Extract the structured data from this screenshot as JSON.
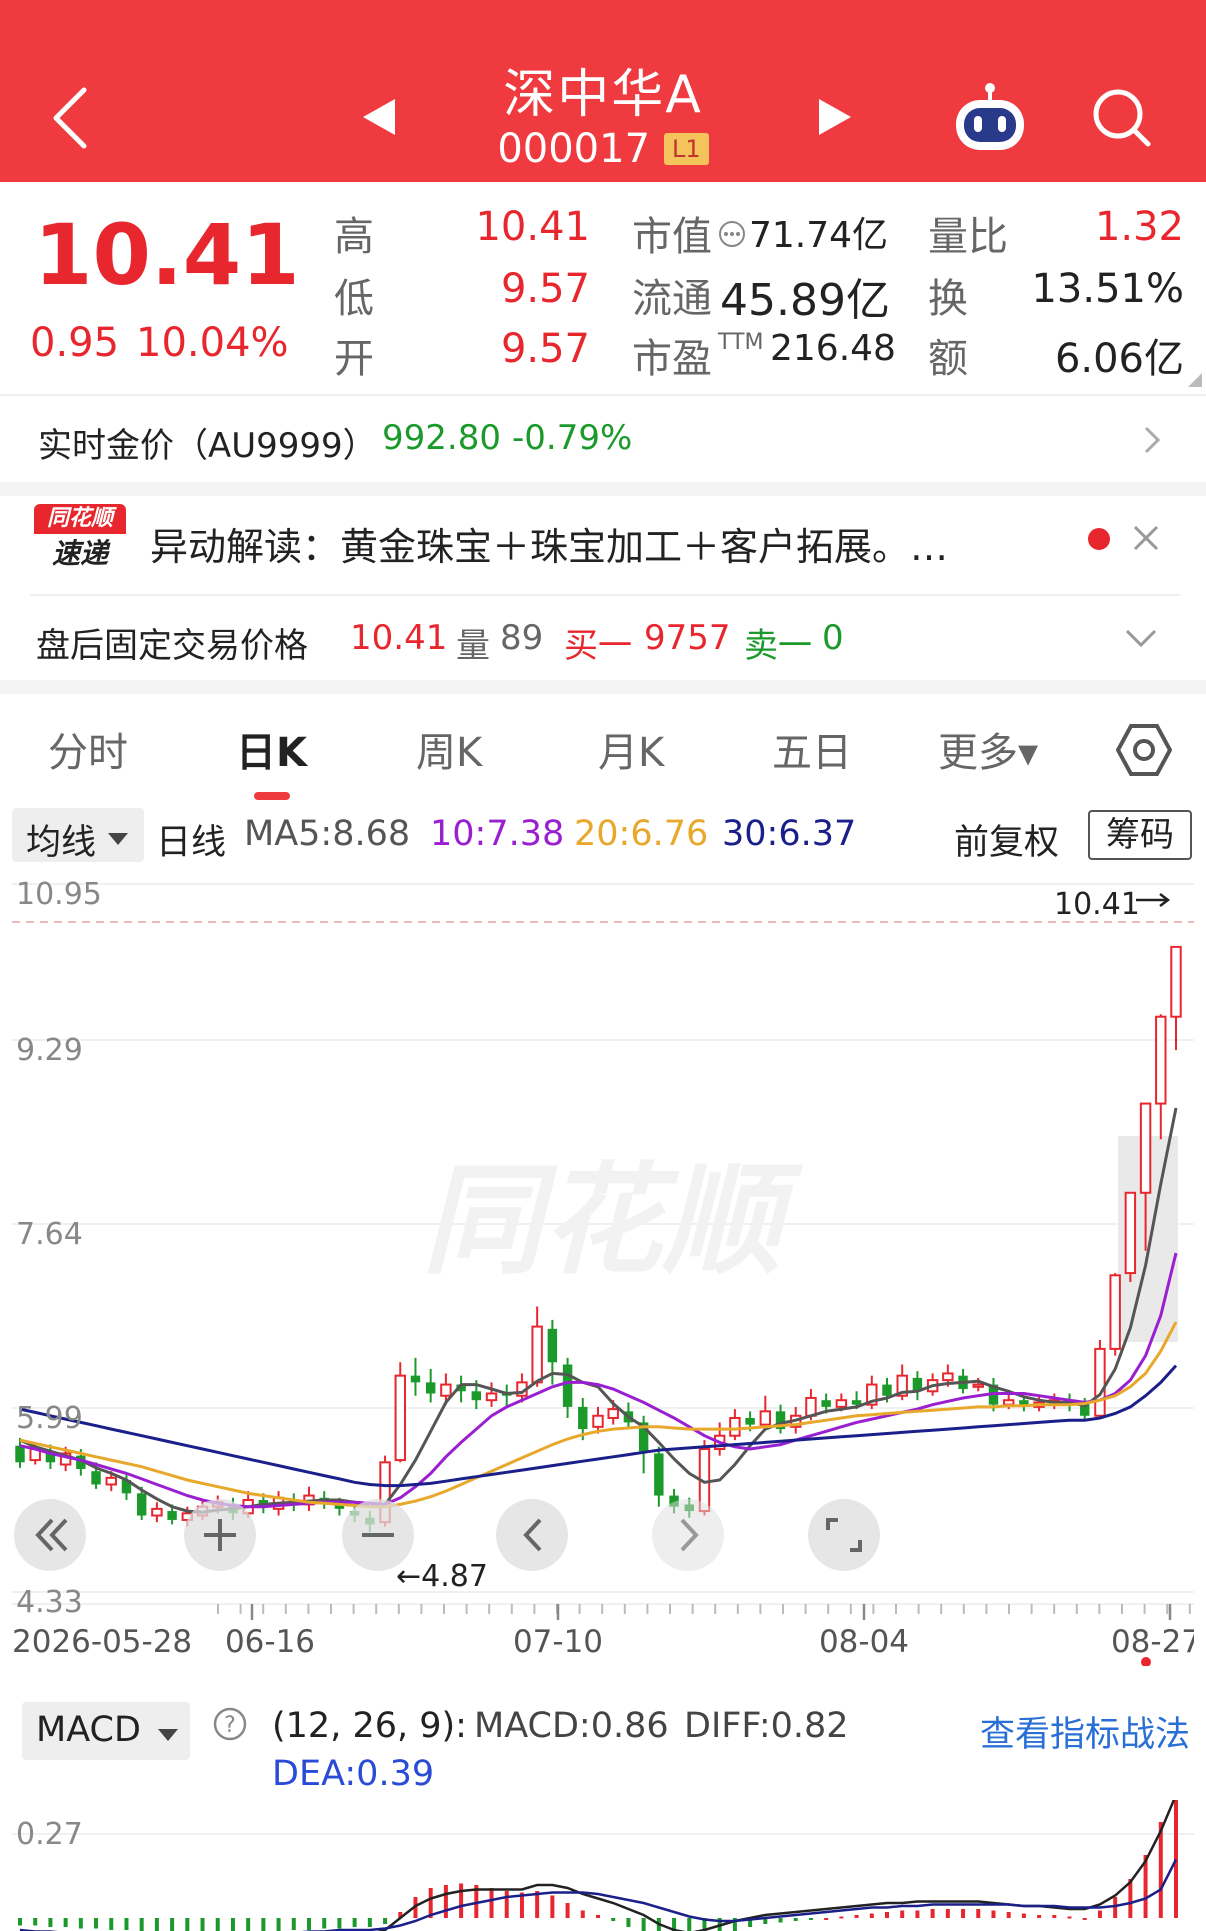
{
  "header": {
    "stock_name": "深中华A",
    "stock_code": "000017",
    "level_badge": "L1"
  },
  "quote": {
    "price": "10.41",
    "change": "0.95",
    "change_pct": "10.04%",
    "high_label": "高",
    "high": "10.41",
    "low_label": "低",
    "low": "9.57",
    "open_label": "开",
    "open": "9.57",
    "mktcap_label": "市值",
    "mktcap": "71.74亿",
    "float_label": "流通",
    "float": "45.89亿",
    "pe_label": "市盈",
    "pe_sup": "TTM",
    "pe": "216.48",
    "volratio_label": "量比",
    "volratio": "1.32",
    "turnover_label": "换",
    "turnover": "13.51%",
    "amount_label": "额",
    "amount": "6.06亿"
  },
  "gold": {
    "label": "实时金价（AU9999）",
    "price": "992.80",
    "change_pct": "-0.79%"
  },
  "news": {
    "logo_top": "同花顺",
    "logo_bottom": "速递",
    "text": "异动解读：黄金珠宝＋珠宝加工＋客户拓展。…"
  },
  "after_hours": {
    "label": "盘后固定交易价格",
    "price": "10.41",
    "vol_label": "量",
    "vol": "89",
    "buy_label": "买一",
    "buy": "9757",
    "sell_label": "卖一",
    "sell": "0"
  },
  "tabs": [
    "分时",
    "日K",
    "周K",
    "月K",
    "五日",
    "更多▾"
  ],
  "active_tab": "日K",
  "ma_bar": {
    "dropdown": "均线",
    "period": "日线",
    "ma5": "MA5:8.68",
    "ma10": "10:7.38",
    "ma20": "20:6.76",
    "ma30": "30:6.37",
    "adjust": "前复权",
    "chip": "筹码"
  },
  "colors": {
    "header_red": "#ef3b3f",
    "up": "#e8262e",
    "down": "#1b9a2b",
    "ma5": "#555555",
    "ma10": "#9a1fd1",
    "ma20": "#e7a82c",
    "ma30": "#1b1f8a"
  },
  "watermark": "同花顺",
  "macd_header": {
    "dropdown": "MACD",
    "params": "(12, 26, 9):",
    "macd": "MACD:0.86",
    "diff": "DIFF:0.82",
    "dea": "DEA:0.39",
    "link": "查看指标战法"
  },
  "chart_data": [
    {
      "type": "candlestick",
      "y_ticks": [
        "10.95",
        "9.29",
        "7.64",
        "5.99",
        "4.33"
      ],
      "ylim": [
        4.33,
        10.95
      ],
      "x_ticks": [
        "2026-05-28",
        "06-16",
        "07-10",
        "08-04",
        "08-27"
      ],
      "annotations": {
        "max_label": "10.41",
        "min_label": "←4.87"
      },
      "candles": [
        [
          5.65,
          5.5,
          5.72,
          5.45
        ],
        [
          5.52,
          5.62,
          5.68,
          5.48
        ],
        [
          5.6,
          5.5,
          5.66,
          5.44
        ],
        [
          5.48,
          5.58,
          5.64,
          5.42
        ],
        [
          5.56,
          5.44,
          5.62,
          5.38
        ],
        [
          5.42,
          5.3,
          5.5,
          5.26
        ],
        [
          5.3,
          5.36,
          5.42,
          5.24
        ],
        [
          5.34,
          5.22,
          5.4,
          5.16
        ],
        [
          5.22,
          5.02,
          5.28,
          4.98
        ],
        [
          5.02,
          5.08,
          5.14,
          4.96
        ],
        [
          5.06,
          4.98,
          5.12,
          4.94
        ],
        [
          4.98,
          5.04,
          5.1,
          4.92
        ],
        [
          5.02,
          5.1,
          5.16,
          4.98
        ],
        [
          5.1,
          5.14,
          5.2,
          5.04
        ],
        [
          5.12,
          5.04,
          5.18,
          4.98
        ],
        [
          5.04,
          5.16,
          5.24,
          5.0
        ],
        [
          5.16,
          5.1,
          5.22,
          5.04
        ],
        [
          5.08,
          5.18,
          5.24,
          5.02
        ],
        [
          5.16,
          5.12,
          5.22,
          5.06
        ],
        [
          5.12,
          5.2,
          5.28,
          5.06
        ],
        [
          5.18,
          5.14,
          5.24,
          5.08
        ],
        [
          5.12,
          5.08,
          5.18,
          5.02
        ],
        [
          5.06,
          5.02,
          5.12,
          4.96
        ],
        [
          5.0,
          4.94,
          5.06,
          4.87
        ],
        [
          4.96,
          5.5,
          5.56,
          4.92
        ],
        [
          5.52,
          6.28,
          6.4,
          5.5
        ],
        [
          6.28,
          6.22,
          6.44,
          6.1
        ],
        [
          6.22,
          6.12,
          6.34,
          6.04
        ],
        [
          6.1,
          6.2,
          6.3,
          6.02
        ],
        [
          6.2,
          6.14,
          6.28,
          6.04
        ],
        [
          6.14,
          6.06,
          6.24,
          5.98
        ],
        [
          6.06,
          6.12,
          6.22,
          6.0
        ],
        [
          6.12,
          6.1,
          6.2,
          6.0
        ],
        [
          6.1,
          6.22,
          6.3,
          6.04
        ],
        [
          6.22,
          6.72,
          6.9,
          6.18
        ],
        [
          6.7,
          6.4,
          6.78,
          6.2
        ],
        [
          6.38,
          6.0,
          6.44,
          5.9
        ],
        [
          6.0,
          5.8,
          6.08,
          5.7
        ],
        [
          5.82,
          5.92,
          6.0,
          5.76
        ],
        [
          5.9,
          5.98,
          6.06,
          5.84
        ],
        [
          5.96,
          5.86,
          6.04,
          5.8
        ],
        [
          5.86,
          5.6,
          5.92,
          5.4
        ],
        [
          5.58,
          5.2,
          5.64,
          5.1
        ],
        [
          5.2,
          5.1,
          5.26,
          5.04
        ],
        [
          5.12,
          5.06,
          5.18,
          5.0
        ],
        [
          5.06,
          5.62,
          5.7,
          5.02
        ],
        [
          5.62,
          5.74,
          5.86,
          5.56
        ],
        [
          5.74,
          5.9,
          5.98,
          5.7
        ],
        [
          5.9,
          5.84,
          5.96,
          5.78
        ],
        [
          5.84,
          5.96,
          6.1,
          5.8
        ],
        [
          5.96,
          5.8,
          6.02,
          5.76
        ],
        [
          5.82,
          5.92,
          6.0,
          5.76
        ],
        [
          5.92,
          6.08,
          6.16,
          5.88
        ],
        [
          6.06,
          6.0,
          6.12,
          5.94
        ],
        [
          6.0,
          6.06,
          6.12,
          5.96
        ],
        [
          6.06,
          6.02,
          6.14,
          5.98
        ],
        [
          6.02,
          6.2,
          6.28,
          5.98
        ],
        [
          6.2,
          6.1,
          6.26,
          6.04
        ],
        [
          6.1,
          6.28,
          6.38,
          6.06
        ],
        [
          6.26,
          6.14,
          6.32,
          6.06
        ],
        [
          6.14,
          6.24,
          6.3,
          6.1
        ],
        [
          6.24,
          6.3,
          6.38,
          6.18
        ],
        [
          6.28,
          6.16,
          6.34,
          6.12
        ],
        [
          6.18,
          6.2,
          6.26,
          6.14
        ],
        [
          6.2,
          6.02,
          6.26,
          5.96
        ],
        [
          6.02,
          6.06,
          6.12,
          5.98
        ],
        [
          6.06,
          6.0,
          6.1,
          5.96
        ],
        [
          6.0,
          6.04,
          6.1,
          5.96
        ],
        [
          6.04,
          6.06,
          6.12,
          5.98
        ],
        [
          6.06,
          6.02,
          6.12,
          5.96
        ],
        [
          6.02,
          5.92,
          6.08,
          5.88
        ],
        [
          5.92,
          6.52,
          6.6,
          5.9
        ],
        [
          6.52,
          7.18,
          7.2,
          6.46
        ],
        [
          7.2,
          7.92,
          7.92,
          7.12
        ],
        [
          7.92,
          8.72,
          8.72,
          7.4
        ],
        [
          8.72,
          9.57,
          9.6,
          8.4
        ],
        [
          9.57,
          10.41,
          10.41,
          9.2
        ]
      ],
      "series": [
        {
          "name": "MA5",
          "values": [
            5.7,
            5.64,
            5.6,
            5.56,
            5.52,
            5.45,
            5.4,
            5.34,
            5.25,
            5.17,
            5.1,
            5.06,
            5.05,
            5.07,
            5.08,
            5.1,
            5.12,
            5.13,
            5.14,
            5.15,
            5.16,
            5.16,
            5.14,
            5.1,
            5.12,
            5.3,
            5.52,
            5.78,
            6.04,
            6.2,
            6.2,
            6.16,
            6.12,
            6.13,
            6.23,
            6.3,
            6.29,
            6.22,
            6.18,
            6.03,
            5.91,
            5.82,
            5.68,
            5.53,
            5.4,
            5.32,
            5.34,
            5.48,
            5.65,
            5.8,
            5.85,
            5.88,
            5.92,
            5.96,
            5.98,
            6.0,
            6.05,
            6.08,
            6.13,
            6.14,
            6.19,
            6.21,
            6.22,
            6.23,
            6.18,
            6.14,
            6.09,
            6.06,
            6.04,
            6.04,
            6.01,
            6.11,
            6.34,
            6.71,
            7.27,
            8.0,
            8.68
          ]
        },
        {
          "name": "10",
          "values": [
            5.65,
            5.62,
            5.58,
            5.55,
            5.52,
            5.48,
            5.44,
            5.4,
            5.35,
            5.3,
            5.25,
            5.2,
            5.16,
            5.13,
            5.11,
            5.1,
            5.1,
            5.11,
            5.12,
            5.13,
            5.14,
            5.14,
            5.14,
            5.13,
            5.12,
            5.18,
            5.28,
            5.4,
            5.55,
            5.68,
            5.8,
            5.92,
            6.0,
            6.06,
            6.12,
            6.18,
            6.22,
            6.22,
            6.2,
            6.16,
            6.1,
            6.04,
            5.97,
            5.9,
            5.82,
            5.74,
            5.68,
            5.64,
            5.62,
            5.64,
            5.66,
            5.7,
            5.74,
            5.78,
            5.82,
            5.86,
            5.89,
            5.92,
            5.95,
            5.98,
            6.02,
            6.05,
            6.08,
            6.1,
            6.12,
            6.12,
            6.12,
            6.1,
            6.08,
            6.06,
            6.04,
            6.06,
            6.12,
            6.24,
            6.46,
            6.82,
            7.38
          ]
        },
        {
          "name": "20",
          "values": [
            5.7,
            5.67,
            5.64,
            5.61,
            5.58,
            5.55,
            5.52,
            5.49,
            5.46,
            5.42,
            5.38,
            5.34,
            5.31,
            5.28,
            5.25,
            5.22,
            5.2,
            5.18,
            5.16,
            5.14,
            5.13,
            5.12,
            5.11,
            5.1,
            5.1,
            5.12,
            5.15,
            5.19,
            5.24,
            5.3,
            5.36,
            5.42,
            5.48,
            5.54,
            5.6,
            5.66,
            5.71,
            5.75,
            5.78,
            5.8,
            5.81,
            5.82,
            5.82,
            5.81,
            5.8,
            5.8,
            5.8,
            5.8,
            5.81,
            5.82,
            5.83,
            5.84,
            5.86,
            5.88,
            5.9,
            5.92,
            5.93,
            5.94,
            5.95,
            5.96,
            5.97,
            5.98,
            5.99,
            6.0,
            6.0,
            6.01,
            6.01,
            6.02,
            6.02,
            6.02,
            6.03,
            6.06,
            6.1,
            6.18,
            6.3,
            6.5,
            6.76
          ]
        },
        {
          "name": "30",
          "values": [
            5.98,
            5.95,
            5.92,
            5.89,
            5.86,
            5.83,
            5.8,
            5.77,
            5.74,
            5.71,
            5.68,
            5.65,
            5.62,
            5.59,
            5.56,
            5.53,
            5.5,
            5.47,
            5.44,
            5.41,
            5.38,
            5.35,
            5.32,
            5.3,
            5.29,
            5.29,
            5.3,
            5.31,
            5.33,
            5.35,
            5.37,
            5.39,
            5.41,
            5.43,
            5.45,
            5.47,
            5.49,
            5.51,
            5.53,
            5.55,
            5.57,
            5.59,
            5.61,
            5.62,
            5.63,
            5.64,
            5.65,
            5.66,
            5.67,
            5.68,
            5.69,
            5.7,
            5.71,
            5.72,
            5.73,
            5.74,
            5.75,
            5.76,
            5.77,
            5.78,
            5.79,
            5.8,
            5.81,
            5.82,
            5.83,
            5.84,
            5.85,
            5.86,
            5.87,
            5.88,
            5.88,
            5.9,
            5.94,
            6.0,
            6.1,
            6.22,
            6.37
          ]
        }
      ]
    },
    {
      "type": "bar",
      "title": "MACD",
      "y_ticks": [
        "0.27"
      ],
      "values": [
        -0.05,
        -0.05,
        -0.06,
        -0.06,
        -0.07,
        -0.07,
        -0.08,
        -0.08,
        -0.09,
        -0.1,
        -0.1,
        -0.11,
        -0.11,
        -0.11,
        -0.1,
        -0.1,
        -0.09,
        -0.09,
        -0.08,
        -0.08,
        -0.07,
        -0.07,
        -0.06,
        -0.06,
        -0.04,
        0.04,
        0.14,
        0.2,
        0.22,
        0.23,
        0.22,
        0.2,
        0.18,
        0.17,
        0.18,
        0.15,
        0.1,
        0.05,
        0.02,
        -0.02,
        -0.06,
        -0.1,
        -0.16,
        -0.2,
        -0.22,
        -0.18,
        -0.14,
        -0.1,
        -0.06,
        -0.04,
        -0.03,
        -0.02,
        -0.01,
        0.0,
        0.01,
        0.02,
        0.03,
        0.04,
        0.05,
        0.05,
        0.06,
        0.06,
        0.06,
        0.06,
        0.05,
        0.04,
        0.03,
        0.02,
        0.02,
        0.01,
        0.0,
        0.05,
        0.14,
        0.26,
        0.42,
        0.64,
        0.86
      ],
      "series": [
        {
          "name": "DIFF",
          "values": [
            -0.1,
            -0.11,
            -0.12,
            -0.13,
            -0.14,
            -0.15,
            -0.16,
            -0.17,
            -0.18,
            -0.19,
            -0.2,
            -0.2,
            -0.2,
            -0.19,
            -0.18,
            -0.17,
            -0.16,
            -0.15,
            -0.14,
            -0.13,
            -0.12,
            -0.11,
            -0.11,
            -0.11,
            -0.08,
            0.0,
            0.08,
            0.13,
            0.16,
            0.18,
            0.19,
            0.19,
            0.19,
            0.19,
            0.22,
            0.22,
            0.2,
            0.16,
            0.13,
            0.1,
            0.06,
            0.02,
            -0.04,
            -0.08,
            -0.1,
            -0.08,
            -0.05,
            -0.02,
            0.0,
            0.02,
            0.03,
            0.04,
            0.05,
            0.06,
            0.07,
            0.08,
            0.09,
            0.1,
            0.1,
            0.11,
            0.11,
            0.11,
            0.11,
            0.11,
            0.1,
            0.09,
            0.08,
            0.08,
            0.07,
            0.06,
            0.06,
            0.09,
            0.15,
            0.24,
            0.38,
            0.58,
            0.82
          ]
        },
        {
          "name": "DEA",
          "values": [
            -0.08,
            -0.09,
            -0.09,
            -0.1,
            -0.11,
            -0.11,
            -0.12,
            -0.13,
            -0.14,
            -0.14,
            -0.15,
            -0.15,
            -0.15,
            -0.14,
            -0.13,
            -0.12,
            -0.12,
            -0.11,
            -0.1,
            -0.09,
            -0.09,
            -0.08,
            -0.08,
            -0.08,
            -0.07,
            -0.05,
            -0.02,
            0.02,
            0.05,
            0.08,
            0.1,
            0.12,
            0.14,
            0.15,
            0.16,
            0.17,
            0.17,
            0.17,
            0.16,
            0.14,
            0.12,
            0.1,
            0.07,
            0.04,
            0.01,
            -0.01,
            -0.02,
            -0.02,
            -0.01,
            0.0,
            0.01,
            0.02,
            0.03,
            0.04,
            0.05,
            0.06,
            0.07,
            0.07,
            0.08,
            0.08,
            0.09,
            0.09,
            0.09,
            0.09,
            0.09,
            0.09,
            0.08,
            0.08,
            0.08,
            0.07,
            0.07,
            0.07,
            0.08,
            0.1,
            0.13,
            0.19,
            0.39
          ]
        }
      ]
    }
  ]
}
